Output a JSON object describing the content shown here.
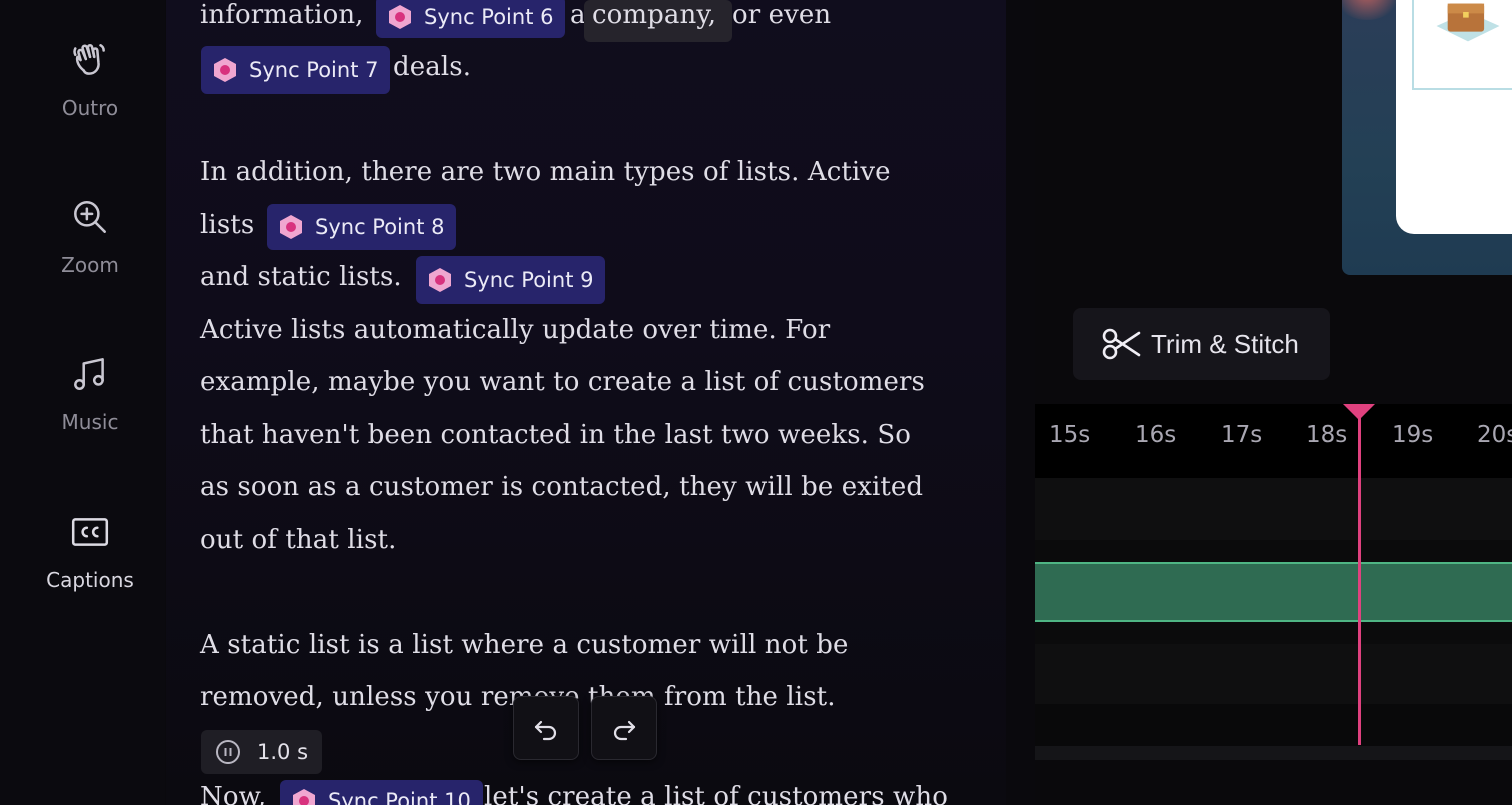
{
  "sidebar": {
    "items": [
      {
        "label": "Outro",
        "icon": "wave-hand-icon",
        "active": false
      },
      {
        "label": "Zoom",
        "icon": "zoom-in-icon",
        "active": false
      },
      {
        "label": "Music",
        "icon": "music-note-icon",
        "active": false
      },
      {
        "label": "Captions",
        "icon": "closed-captions-icon",
        "active": true
      }
    ]
  },
  "transcript": {
    "line1_a": "information,",
    "sync6": "Sync Point 6",
    "line1_b": "a",
    "line1_chip": "company,",
    "line1_c": "or even",
    "sync7": "Sync Point 7",
    "line2": "deals.",
    "line3": "In addition, there are two main types of lists. Active",
    "line4": "lists",
    "sync8": "Sync Point 8",
    "line5": "and static lists.",
    "sync9": "Sync Point 9",
    "line6": "Active lists automatically update over time. For",
    "line7": "example, maybe you want to create a list of customers",
    "line8": "that haven't been contacted in the last two weeks. So",
    "line9": "as soon as a customer is contacted, they will be exited",
    "line10": "out of that list.",
    "line11": "A static list is a list where a customer will not be",
    "line12": "removed, unless you remove them from the list.",
    "pause": "1.0 s",
    "line13_a": "Now,",
    "sync10": "Sync Point 10",
    "line13_b": "let's create a list of customers who"
  },
  "controls": {
    "undo_icon": "undo-icon",
    "redo_icon": "redo-icon"
  },
  "editor": {
    "trim_label": "Trim & Stitch",
    "ticks": [
      "15s",
      "16s",
      "17s",
      "18s",
      "19s",
      "20s"
    ],
    "playhead_color": "#e0417f",
    "clip_color": "#2f6b52"
  }
}
